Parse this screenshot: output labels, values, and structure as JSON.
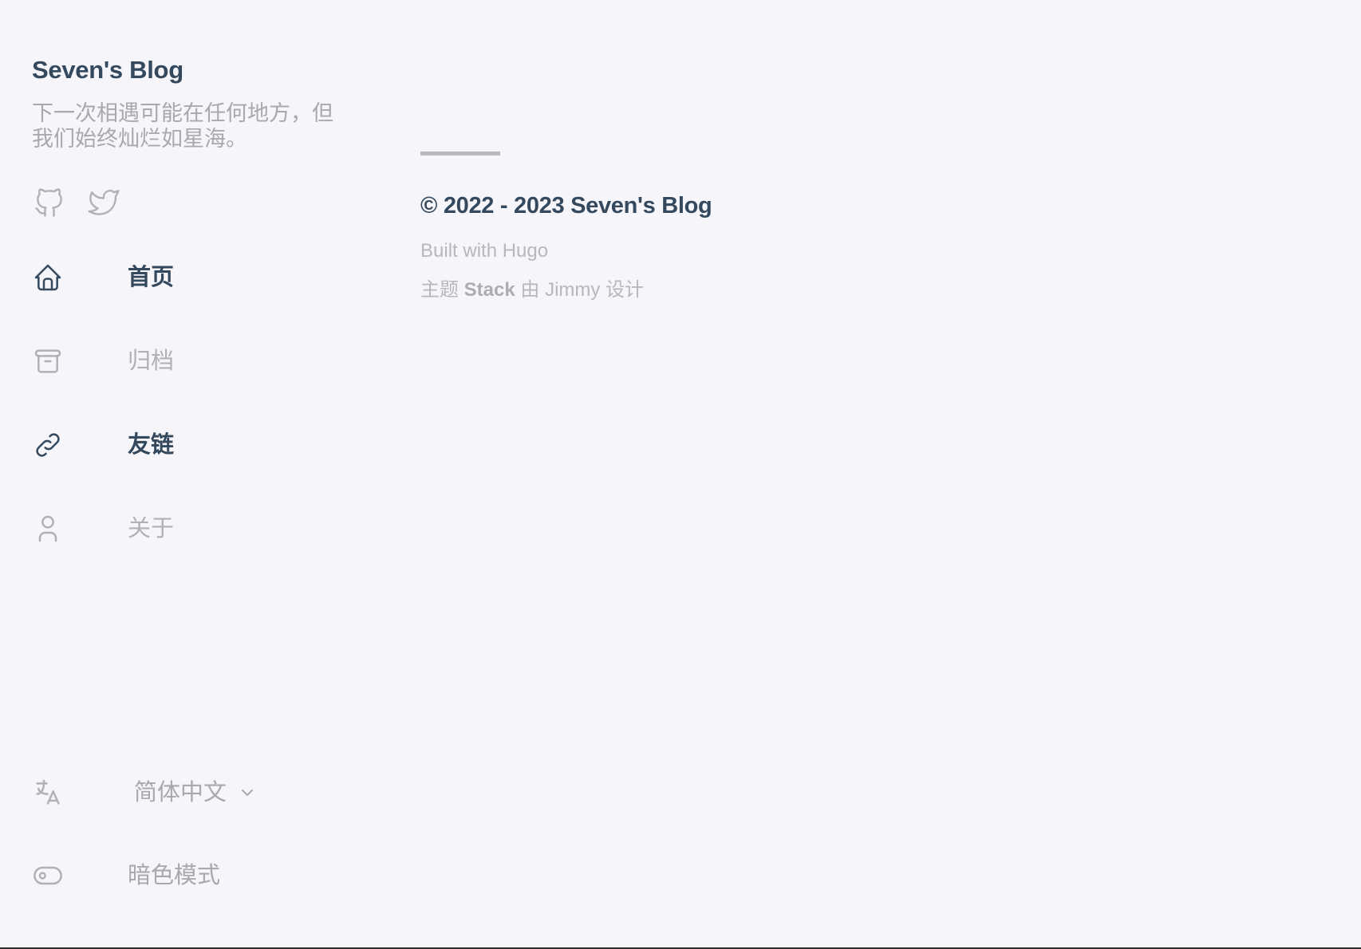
{
  "site": {
    "title": "Seven's Blog",
    "description": "下一次相遇可能在任何地方，但我们始终灿烂如星海。"
  },
  "social": [
    {
      "icon": "github-icon"
    },
    {
      "icon": "twitter-icon"
    }
  ],
  "menu": [
    {
      "label": "首页",
      "icon": "home-icon",
      "active": true
    },
    {
      "label": "归档",
      "icon": "archive-icon",
      "active": false
    },
    {
      "label": "友链",
      "icon": "link-icon",
      "active": true
    },
    {
      "label": "关于",
      "icon": "user-icon",
      "active": false
    }
  ],
  "language": {
    "icon": "language-icon",
    "selected": "简体中文"
  },
  "dark_mode": {
    "icon": "toggle-icon",
    "label": "暗色模式"
  },
  "footer": {
    "copyright": "© 2022 - 2023 Seven's Blog",
    "built_with_prefix": "Built with",
    "built_with_link": "Hugo",
    "theme_prefix": "主题",
    "theme_name": "Stack",
    "theme_by": "由",
    "theme_author": "Jimmy",
    "theme_suffix": "设计"
  },
  "colors": {
    "background": "#f5f5fa",
    "primary_text": "#34495e",
    "muted_text": "#b1b1b4"
  }
}
